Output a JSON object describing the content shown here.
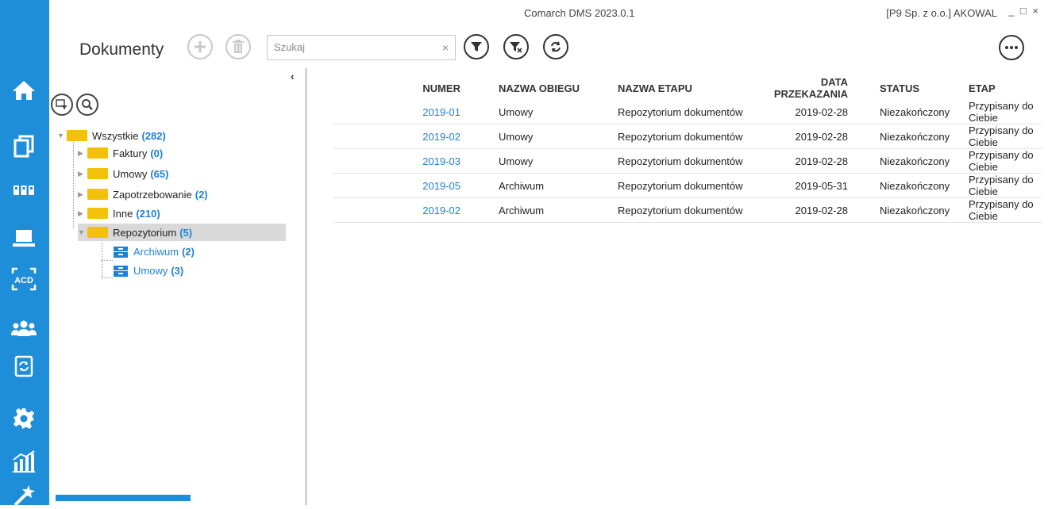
{
  "window": {
    "title": "Comarch DMS 2023.0.1",
    "company": "[P9 Sp. z o.o.] AKOWAL",
    "controls": [
      "_",
      "□",
      "×"
    ]
  },
  "sidebar": {
    "items": [
      {
        "name": "home-icon"
      },
      {
        "name": "documents-icon"
      },
      {
        "name": "workflow-icon"
      },
      {
        "name": "computer-icon"
      },
      {
        "name": "acd-icon",
        "label": "ACD"
      },
      {
        "name": "users-icon"
      },
      {
        "name": "sync-document-icon"
      },
      {
        "name": "settings-icon"
      },
      {
        "name": "analytics-icon"
      },
      {
        "name": "magic-icon"
      }
    ]
  },
  "toolbar": {
    "page_title": "Dokumenty",
    "search_placeholder": "Szukaj",
    "buttons": [
      "add-icon",
      "delete-icon",
      "filter-icon",
      "clear-filter-icon",
      "refresh-icon",
      "more-icon"
    ]
  },
  "tree": {
    "collapse_arrow": "‹",
    "items": [
      {
        "label": "Wszystkie",
        "count": "(282)",
        "level": 0
      },
      {
        "label": "Faktury",
        "count": "(0)",
        "level": 1
      },
      {
        "label": "Umowy",
        "count": "(65)",
        "level": 1
      },
      {
        "label": "Zapotrzebowanie",
        "count": "(2)",
        "level": 1
      },
      {
        "label": "Inne",
        "count": "(210)",
        "level": 1
      },
      {
        "label": "Repozytorium",
        "count": "(5)",
        "level": 1,
        "selected": true
      },
      {
        "label": "Archiwum",
        "count": "(2)",
        "level": 2
      },
      {
        "label": "Umowy",
        "count": "(3)",
        "level": 2
      }
    ]
  },
  "table": {
    "columns": [
      "NUMER",
      "NAZWA OBIEGU",
      "NAZWA ETAPU",
      "DATA PRZEKAZANIA",
      "STATUS",
      "ETAP"
    ],
    "rows": [
      [
        "2019-01",
        "Umowy",
        "Repozytorium dokumentów",
        "2019-02-28",
        "Niezakończony",
        "Przypisany do Ciebie"
      ],
      [
        "2019-02",
        "Umowy",
        "Repozytorium dokumentów",
        "2019-02-28",
        "Niezakończony",
        "Przypisany do Ciebie"
      ],
      [
        "2019-03",
        "Umowy",
        "Repozytorium dokumentów",
        "2019-02-28",
        "Niezakończony",
        "Przypisany do Ciebie"
      ],
      [
        "2019-05",
        "Archiwum",
        "Repozytorium dokumentów",
        "2019-05-31",
        "Niezakończony",
        "Przypisany do Ciebie"
      ],
      [
        "2019-02",
        "Archiwum",
        "Repozytorium dokumentów",
        "2019-02-28",
        "Niezakończony",
        "Przypisany do Ciebie"
      ]
    ]
  },
  "colors": {
    "accent": "#1e8ed8",
    "link": "#1e7fd6",
    "folder": "#f4c10a"
  }
}
